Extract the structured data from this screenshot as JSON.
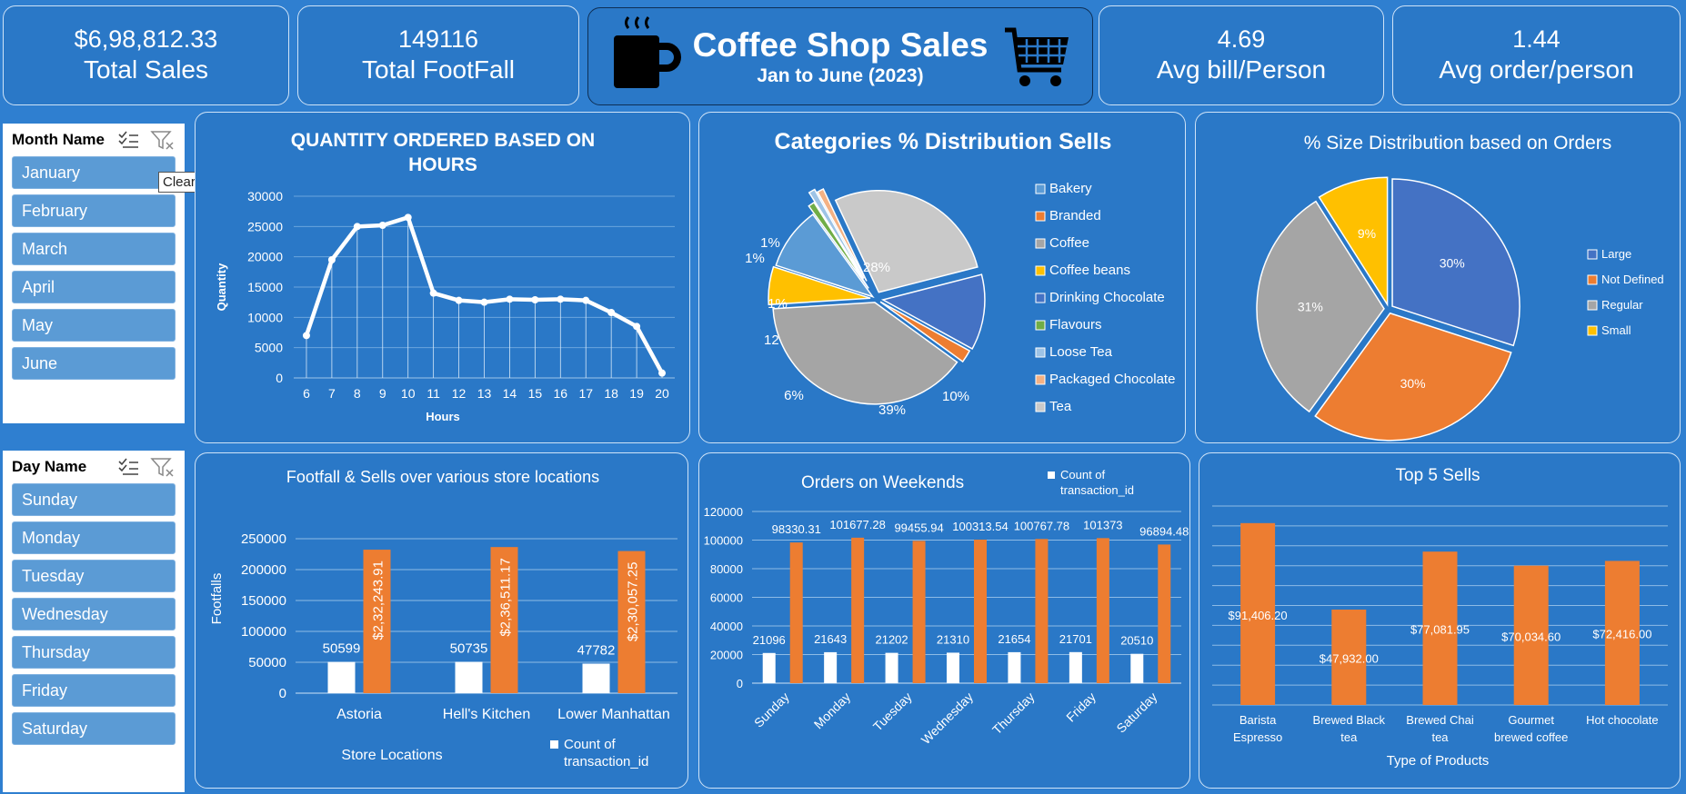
{
  "kpis": {
    "total_sales": {
      "value": "$6,98,812.33",
      "label": "Total Sales"
    },
    "total_footfall": {
      "value": "149116",
      "label": "Total FootFall"
    },
    "avg_bill": {
      "value": "4.69",
      "label": "Avg bill/Person"
    },
    "avg_order": {
      "value": "1.44",
      "label": "Avg order/person"
    }
  },
  "header": {
    "title": "Coffee Shop Sales",
    "subtitle": "Jan to June (2023)"
  },
  "month_slicer": {
    "title": "Month Name",
    "items": [
      "January",
      "February",
      "March",
      "April",
      "May",
      "June"
    ],
    "tooltip": "Clear Filter (Alt+C)"
  },
  "day_slicer": {
    "title": "Day Name",
    "items": [
      "Sunday",
      "Monday",
      "Tuesday",
      "Wednesday",
      "Thursday",
      "Friday",
      "Saturday"
    ]
  },
  "colors": {
    "background": "#2f7fd0",
    "card": "#2a78c7",
    "orange": "#ed7d31",
    "white": "#ffffff"
  },
  "chart_data": [
    {
      "type": "line",
      "title": "QUANTITY ORDERED BASED ON HOURS",
      "xlabel": "Hours",
      "ylabel": "Quantity",
      "x": [
        6,
        7,
        8,
        9,
        10,
        11,
        12,
        13,
        14,
        15,
        16,
        17,
        18,
        19,
        20
      ],
      "values": [
        7000,
        19500,
        25000,
        25200,
        26500,
        14000,
        12800,
        12500,
        13000,
        12900,
        13000,
        12800,
        10800,
        8500,
        800
      ],
      "ylim": [
        0,
        30000
      ],
      "yticks": [
        0,
        5000,
        10000,
        15000,
        20000,
        25000,
        30000
      ]
    },
    {
      "type": "pie",
      "title": "Categories % Distribution Sells",
      "slices": [
        {
          "label": "Bakery",
          "value": 10,
          "text": "10%",
          "color": "#5b9bd5"
        },
        {
          "label": "Branded",
          "value": 2,
          "text": "2%",
          "color": "#ed7d31"
        },
        {
          "label": "Coffee",
          "value": 39,
          "text": "39%",
          "color": "#a5a5a5"
        },
        {
          "label": "Coffee beans",
          "value": 6,
          "text": "6%",
          "color": "#ffc000"
        },
        {
          "label": "Drinking Chocolate",
          "value": 12,
          "text": "12%",
          "color": "#4472c4"
        },
        {
          "label": "Flavours",
          "value": 1,
          "text": "1%",
          "color": "#70ad47"
        },
        {
          "label": "Loose Tea",
          "value": 1,
          "text": "1%",
          "color": "#9dc3e6"
        },
        {
          "label": "Packaged Chocolate",
          "value": 1,
          "text": "1%",
          "color": "#f4b183"
        },
        {
          "label": "Tea",
          "value": 28,
          "text": "28%",
          "color": "#c9c9c9"
        }
      ],
      "legend": "right"
    },
    {
      "type": "pie",
      "title": "% Size Distribution based on Orders",
      "slices": [
        {
          "label": "Large",
          "value": 30,
          "text": "30%",
          "color": "#4472c4"
        },
        {
          "label": "Not Defined",
          "value": 30,
          "text": "30%",
          "color": "#ed7d31"
        },
        {
          "label": "Regular",
          "value": 31,
          "text": "31%",
          "color": "#a5a5a5"
        },
        {
          "label": "Small",
          "value": 9,
          "text": "9%",
          "color": "#ffc000"
        }
      ],
      "legend": "right"
    },
    {
      "type": "bar",
      "title": "Footfall & Sells over various store locations",
      "xlabel": "Store Locations",
      "ylabel": "Footfalls",
      "categories": [
        "Astoria",
        "Hell's Kitchen",
        "Lower Manhattan"
      ],
      "series": [
        {
          "name": "Count of transaction_id",
          "values": [
            50599,
            50735,
            47782
          ],
          "labels": [
            "50599",
            "50735",
            "47782"
          ]
        },
        {
          "values": [
            232243.91,
            236511.17,
            230057.25
          ],
          "labels": [
            "$2,32,243.91",
            "$2,36,511.17",
            "$2,30,057.25"
          ]
        }
      ],
      "ylim": [
        0,
        250000
      ],
      "yticks": [
        0,
        50000,
        100000,
        150000,
        200000,
        250000
      ]
    },
    {
      "type": "bar",
      "title": "Orders on Weekends",
      "categories": [
        "Sunday",
        "Monday",
        "Tuesday",
        "Wednesday",
        "Thursday",
        "Friday",
        "Saturday"
      ],
      "series": [
        {
          "name": "Count of transaction_id",
          "values": [
            21096,
            21643,
            21202,
            21310,
            21654,
            21701,
            20510
          ],
          "labels": [
            "21096",
            "21643",
            "21202",
            "21310",
            "21654",
            "21701",
            "20510"
          ]
        },
        {
          "values": [
            98330.31,
            101677.28,
            99455.94,
            100313.54,
            100767.78,
            101373,
            96894.48
          ],
          "labels": [
            "98330.31",
            "101677.28",
            "99455.94",
            "100313.54",
            "100767.78",
            "101373",
            "96894.48"
          ]
        }
      ],
      "ylim": [
        0,
        120000
      ],
      "yticks": [
        0,
        20000,
        40000,
        60000,
        80000,
        100000,
        120000
      ]
    },
    {
      "type": "bar",
      "title": "Top 5 Sells",
      "xlabel": "Type of Products",
      "categories": [
        [
          "Barista",
          "Espresso"
        ],
        [
          "Brewed Black",
          "tea"
        ],
        [
          "Brewed Chai",
          "tea"
        ],
        [
          "Gourmet",
          "brewed coffee"
        ],
        [
          "Hot chocolate"
        ]
      ],
      "values": [
        91406.2,
        47932.0,
        77081.95,
        70034.6,
        72416.0
      ],
      "labels": [
        "$91,406.20",
        "$47,932.00",
        "$77,081.95",
        "$70,034.60",
        "$72,416.00"
      ],
      "ylim": [
        0,
        100000
      ]
    }
  ]
}
